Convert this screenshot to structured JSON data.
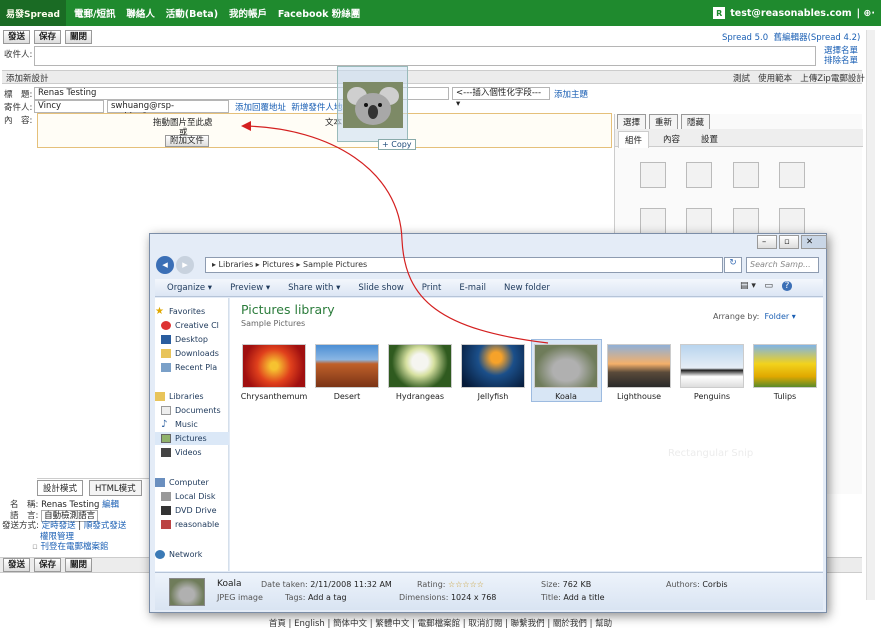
{
  "topbar": {
    "logo": "易發Spread",
    "nav": [
      "電郵/短訊",
      "聯絡人",
      "活動(Beta)",
      "我的帳戶",
      "Facebook 粉絲團"
    ],
    "account_badge": "R",
    "account": "test@reasonables.com",
    "account_menu": "| ⊕·"
  },
  "toolbar": {
    "send": "發送",
    "save": "保存",
    "close": "關閉"
  },
  "versions": {
    "current": "Spread 5.0",
    "old": "舊編輯器(Spread 4.2)"
  },
  "recipients": {
    "label": "收件人:",
    "select": "選擇名單",
    "exclude": "排除名單"
  },
  "design_bar": {
    "title": "添加新設計",
    "test": "測試",
    "use_template": "使用範本",
    "upload_zip": "上傳Zip電郵設計"
  },
  "form": {
    "subject_label": "標　題:",
    "subject_value": "Renas Testing",
    "insert_field": "<---插入個性化字段--- ▾",
    "add_topic": "添加主題",
    "sender_label": "寄件人:",
    "sender_name": "Vincy",
    "sender_email": "swhuang@rsp-archive2.com ▾",
    "add_reply": "添加回覆地址",
    "add_new_sender": "新增發件人地址",
    "content_label": "內　容:"
  },
  "editor": {
    "drop_hint": "拖動圖片至此處",
    "or": "或",
    "attach": "附加文件",
    "text_label": "文本",
    "copy_label": "+ Copy"
  },
  "right_panel": {
    "tabs": [
      "選擇",
      "重新",
      "隱藏"
    ],
    "subtabs": [
      "組件",
      "內容",
      "設置"
    ]
  },
  "mode_tabs": [
    "設計模式",
    "HTML模式"
  ],
  "bottom_form": {
    "name_label": "名　稱:",
    "name_value": "Renas Testing",
    "name_edit": "編輯",
    "lang_label": "語　言:",
    "lang_value": "自動檢測語言",
    "method_label": "發送方式:",
    "method_a": "定時發送",
    "method_sep": "|",
    "method_b": "順發式發送",
    "permissions": "權限管理",
    "archive": "刊登在電郵檔案館"
  },
  "explorer": {
    "breadcrumb": "▸ Libraries ▸ Pictures ▸ Sample Pictures",
    "search_placeholder": "Search Samp...",
    "commands": [
      "Organize ▾",
      "Preview ▾",
      "Share with ▾",
      "Slide show",
      "Print",
      "E-mail",
      "New folder"
    ],
    "nav": {
      "favorites": "Favorites",
      "fav_items": [
        "Creative Cl",
        "Desktop",
        "Downloads",
        "Recent Pla"
      ],
      "libraries": "Libraries",
      "lib_items": [
        "Documents",
        "Music",
        "Pictures",
        "Videos"
      ],
      "computer": "Computer",
      "comp_items": [
        "Local Disk",
        "DVD Drive",
        "reasonable"
      ],
      "network": "Network"
    },
    "library_title": "Pictures library",
    "library_sub": "Sample Pictures",
    "arrange_label": "Arrange by:",
    "arrange_value": "Folder ▾",
    "files": [
      "Chrysanthemum",
      "Desert",
      "Hydrangeas",
      "Jellyfish",
      "Koala",
      "Lighthouse",
      "Penguins",
      "Tulips"
    ],
    "selected_index": 4,
    "details": {
      "name": "Koala",
      "type": "JPEG image",
      "date_label": "Date taken:",
      "date_value": "2/11/2008 11:32 AM",
      "tags_label": "Tags:",
      "tags_value": "Add a tag",
      "rating_label": "Rating:",
      "rating_stars": 0,
      "dim_label": "Dimensions:",
      "dim_value": "1024 x 768",
      "size_label": "Size:",
      "size_value": "762 KB",
      "title_label": "Title:",
      "title_value": "Add a title",
      "authors_label": "Authors:",
      "authors_value": "Corbis"
    },
    "watermark": "Rectangular Snip"
  },
  "footer": "首頁 | English | 簡体中文 | 繁體中文 | 電郵檔案館 | 取消訂閱 | 聯繫我們 | 關於我們 | 幫助",
  "colors": {
    "brand_green": "#1f8a2e",
    "link_blue": "#1a5fb4",
    "explorer_title": "#2b7c3b"
  }
}
